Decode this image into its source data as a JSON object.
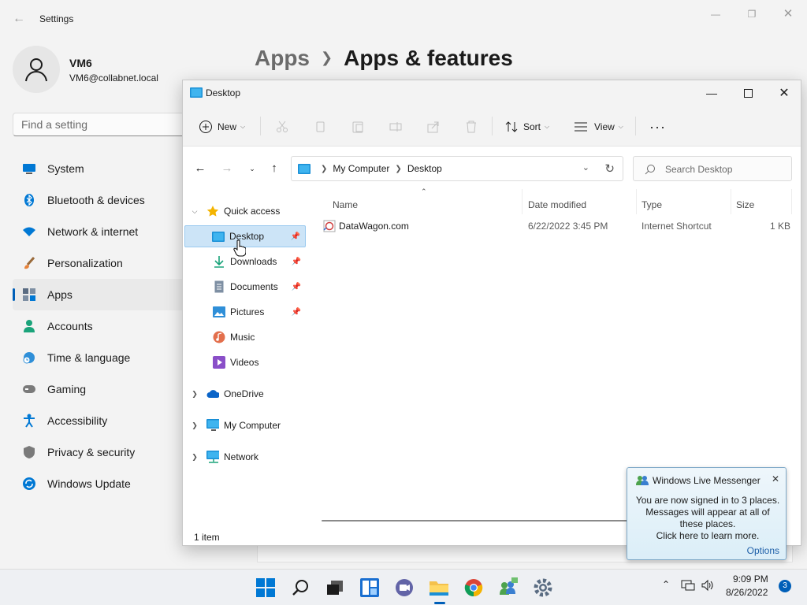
{
  "settings": {
    "window_title": "Settings",
    "user": {
      "name": "VM6",
      "email": "VM6@collabnet.local"
    },
    "search_placeholder": "Find a setting",
    "nav": [
      {
        "label": "System",
        "icon": "monitor-icon"
      },
      {
        "label": "Bluetooth & devices",
        "icon": "bluetooth-icon"
      },
      {
        "label": "Network & internet",
        "icon": "wifi-icon"
      },
      {
        "label": "Personalization",
        "icon": "brush-icon"
      },
      {
        "label": "Apps",
        "icon": "apps-icon",
        "active": true
      },
      {
        "label": "Accounts",
        "icon": "person-icon"
      },
      {
        "label": "Time & language",
        "icon": "clock-globe-icon"
      },
      {
        "label": "Gaming",
        "icon": "gamepad-icon"
      },
      {
        "label": "Accessibility",
        "icon": "accessibility-icon"
      },
      {
        "label": "Privacy & security",
        "icon": "shield-icon"
      },
      {
        "label": "Windows Update",
        "icon": "update-icon"
      }
    ],
    "breadcrumb": {
      "parent": "Apps",
      "current": "Apps & features"
    }
  },
  "explorer": {
    "title": "Desktop",
    "toolbar": {
      "new_label": "New",
      "sort_label": "Sort",
      "view_label": "View"
    },
    "address": {
      "root": "My Computer",
      "current": "Desktop"
    },
    "search_placeholder": "Search Desktop",
    "tree": {
      "quick_access": "Quick access",
      "pinned": [
        "Desktop",
        "Downloads",
        "Documents",
        "Pictures"
      ],
      "unpinned": [
        "Music",
        "Videos"
      ],
      "roots": [
        "OneDrive",
        "My Computer",
        "Network"
      ]
    },
    "columns": {
      "name": "Name",
      "date": "Date modified",
      "type": "Type",
      "size": "Size"
    },
    "files": [
      {
        "name": "DataWagon.com",
        "date": "6/22/2022 3:45 PM",
        "type": "Internet Shortcut",
        "size": "1 KB"
      }
    ],
    "status": "1 item"
  },
  "toast": {
    "title": "Windows Live Messenger",
    "body": "You are now signed in to 3 places. Messages will appear at all of these places.",
    "link": "Click here to learn more.",
    "options": "Options"
  },
  "taskbar": {
    "time": "9:09 PM",
    "date": "8/26/2022",
    "notification_count": "3"
  },
  "colors": {
    "accent": "#005fb8",
    "selection": "#cce4f7",
    "folder": "#f4c14c"
  }
}
